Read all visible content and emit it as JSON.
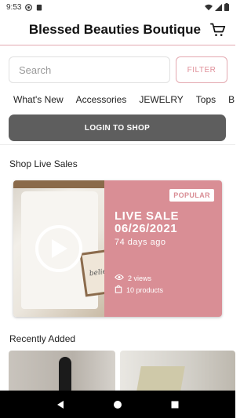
{
  "status_bar": {
    "time": "9:53",
    "icons": [
      "sim-icon",
      "clipboard-icon",
      "wifi-icon",
      "signal-icon",
      "battery-icon"
    ]
  },
  "header": {
    "title": "Blessed Beauties Boutique",
    "cart_icon": "cart-icon"
  },
  "search": {
    "placeholder": "Search",
    "value": "",
    "filter_label": "FILTER"
  },
  "categories": [
    "What's New",
    "Accessories",
    "JEWELRY",
    "Tops",
    "B"
  ],
  "login": {
    "label": "LOGIN TO SHOP"
  },
  "live_sales": {
    "section_title": "Shop Live Sales",
    "card": {
      "badge": "POPULAR",
      "label": "LIVE SALE",
      "date": "06/26/2021",
      "ago": "74 days ago",
      "views": "2 views",
      "products": "10 products",
      "sign_text": "belie"
    }
  },
  "recently_added": {
    "section_title": "Recently Added"
  },
  "colors": {
    "accent_pink": "#d98e95",
    "border_pink": "#e4a9b0",
    "login_gray": "#5e5e5e",
    "nav_black": "#000000"
  },
  "nav_bar": {
    "buttons": [
      "back-icon",
      "home-icon",
      "recents-icon"
    ]
  }
}
